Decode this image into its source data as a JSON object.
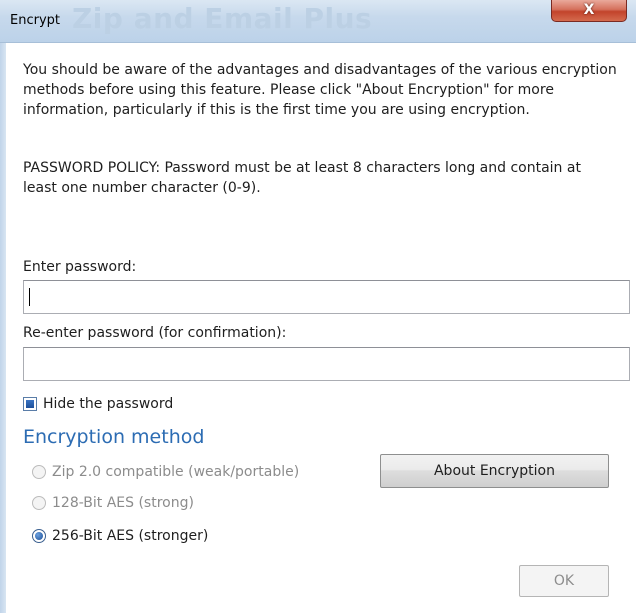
{
  "window": {
    "title": "Encrypt",
    "watermark": "Zip and Email Plus",
    "close_label": "X"
  },
  "intro_text": "You should be aware of the advantages and disadvantages of the various encryption methods before using this feature. Please click \"About Encryption\" for more information, particularly if this is the first time you are using encryption.",
  "policy_text": "PASSWORD POLICY: Password must be at least 8 characters long and contain at least one number character (0-9).",
  "password": {
    "label": "Enter password:",
    "value": ""
  },
  "confirm_password": {
    "label": "Re-enter password (for confirmation):",
    "value": ""
  },
  "hide_password": {
    "label": "Hide the password",
    "checked": true
  },
  "encryption": {
    "title": "Encryption method",
    "options": [
      {
        "label": "Zip 2.0 compatible (weak/portable)",
        "selected": false,
        "enabled": false
      },
      {
        "label": "128-Bit AES (strong)",
        "selected": false,
        "enabled": false
      },
      {
        "label": "256-Bit AES (stronger)",
        "selected": true,
        "enabled": true
      }
    ]
  },
  "buttons": {
    "about_label": "About Encryption",
    "ok_label": "OK"
  },
  "colors": {
    "section_title": "#2c6cb3",
    "disabled_text": "#8c8c8c"
  }
}
